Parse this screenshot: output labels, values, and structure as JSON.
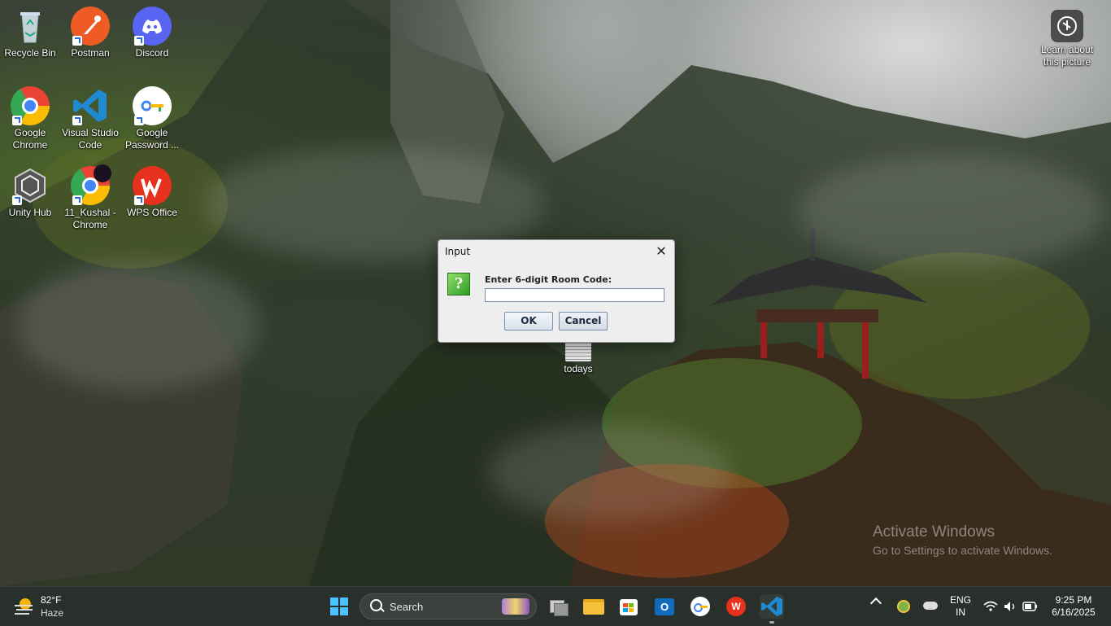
{
  "desktop": {
    "icons": [
      {
        "label": "Recycle Bin",
        "icon": "recycle-bin-icon"
      },
      {
        "label": "Postman",
        "icon": "postman-icon"
      },
      {
        "label": "Discord",
        "icon": "discord-icon"
      },
      {
        "label": "Google Chrome",
        "icon": "chrome-icon"
      },
      {
        "label": "Visual Studio Code",
        "icon": "vscode-icon"
      },
      {
        "label": "Google Password ...",
        "icon": "key-icon"
      },
      {
        "label": "Unity Hub",
        "icon": "unity-icon"
      },
      {
        "label": "11_Kushal - Chrome",
        "icon": "chrome-profile-icon"
      },
      {
        "label": "WPS Office",
        "icon": "wps-icon"
      },
      {
        "label": "todays",
        "icon": "text-file-icon"
      }
    ],
    "learn_about": "Learn about this picture",
    "watermark_title": "Activate Windows",
    "watermark_sub": "Go to Settings to activate Windows."
  },
  "dialog": {
    "title": "Input",
    "prompt": "Enter 6-digit Room Code:",
    "input_value": "",
    "ok_label": "OK",
    "cancel_label": "Cancel"
  },
  "taskbar": {
    "weather_temp": "82°F",
    "weather_desc": "Haze",
    "search_placeholder": "Search",
    "lang_top": "ENG",
    "lang_bottom": "IN",
    "time": "9:25 PM",
    "date": "6/16/2025"
  },
  "colors": {
    "accent": "#0078d4",
    "dialog_bg": "#eeeeee"
  }
}
